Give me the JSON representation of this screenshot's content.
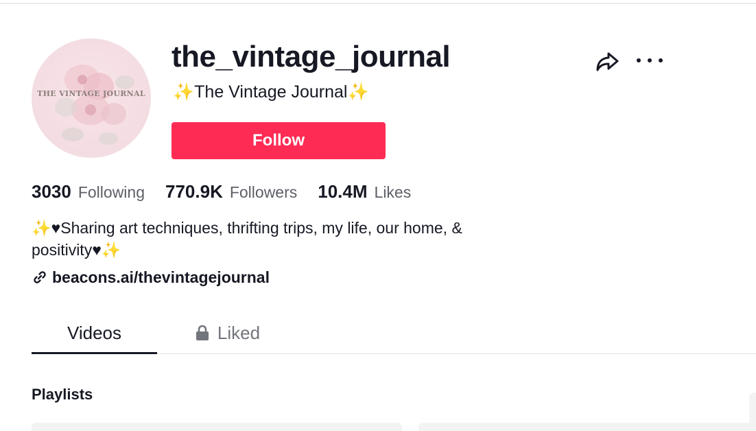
{
  "profile": {
    "username": "the_vintage_journal",
    "nickname_prefix": "✨",
    "nickname": "The Vintage Journal",
    "nickname_suffix": "✨",
    "avatar_text": "THE VINTAGE JOURNAL",
    "follow_label": "Follow"
  },
  "stats": {
    "following_count": "3030",
    "following_label": "Following",
    "followers_count": "770.9K",
    "followers_label": "Followers",
    "likes_count": "10.4M",
    "likes_label": "Likes"
  },
  "bio": {
    "text": "✨♥Sharing art techniques, thrifting trips, my life, our home, & positivity♥✨",
    "link": "beacons.ai/thevintagejournal"
  },
  "tabs": {
    "videos": "Videos",
    "liked": "Liked"
  },
  "sections": {
    "playlists_title": "Playlists"
  },
  "colors": {
    "follow_button": "#fe2c55",
    "text_primary": "#161823",
    "text_secondary": "#5c5f66",
    "sparkle": "#f5c518"
  },
  "icons": {
    "share": "share-icon",
    "more": "more-icon",
    "link": "link-icon",
    "lock": "lock-icon"
  }
}
